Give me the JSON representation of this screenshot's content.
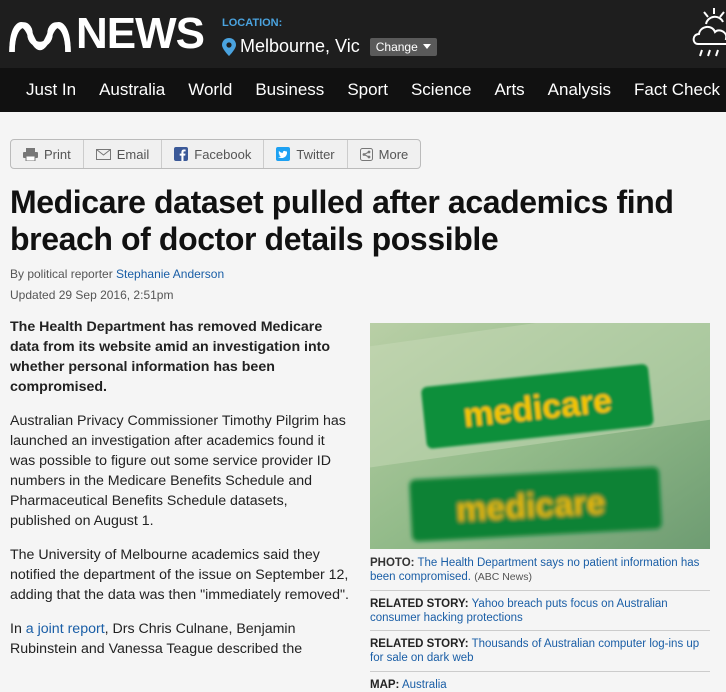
{
  "header": {
    "logo_text": "NEWS",
    "location_label": "LOCATION:",
    "city": "Melbourne, Vic",
    "change_label": "Change"
  },
  "nav": {
    "items": [
      "Just In",
      "Australia",
      "World",
      "Business",
      "Sport",
      "Science",
      "Arts",
      "Analysis",
      "Fact Check"
    ]
  },
  "share": {
    "buttons": [
      "Print",
      "Email",
      "Facebook",
      "Twitter",
      "More"
    ]
  },
  "article": {
    "headline": "Medicare dataset pulled after academics find breach of doctor details possible",
    "byline_prefix": "By political reporter ",
    "author": "Stephanie Anderson",
    "updated": "Updated 29 Sep 2016, 2:51pm",
    "lead": "The Health Department has removed Medicare data from its website amid an investigation into whether personal information has been compromised.",
    "p1": "Australian Privacy Commissioner Timothy Pilgrim has launched an investigation after academics found it was possible to figure out some service provider ID numbers in the Medicare Benefits Schedule and Pharmaceutical Benefits Schedule datasets, published on August 1.",
    "p2": "The University of Melbourne academics said they notified the department of the issue on September 12, adding that the data was then \"immediately removed\".",
    "p3_prefix": "In ",
    "p3_link": "a joint report",
    "p3_suffix": ", Drs Chris Culnane, Benjamin Rubinstein and Vanessa Teague described the"
  },
  "photo": {
    "card_text_1": "medicare",
    "card_text_2": "medicare",
    "caption_label": "PHOTO:",
    "caption_text": "The Health Department says no patient information has been compromised.",
    "caption_source": "(ABC News)"
  },
  "related": [
    {
      "label": "RELATED STORY:",
      "text": "Yahoo breach puts focus on Australian consumer hacking protections"
    },
    {
      "label": "RELATED STORY:",
      "text": "Thousands of Australian computer log-ins up for sale on dark web"
    }
  ],
  "map": {
    "label": "MAP:",
    "text": "Australia"
  },
  "colors": {
    "masthead": "#1e1e1e",
    "nav": "#111111",
    "accent": "#4aa3df",
    "link": "#1a5ea6",
    "medicare_green": "#0b8f3a",
    "medicare_yellow": "#f5c400"
  }
}
